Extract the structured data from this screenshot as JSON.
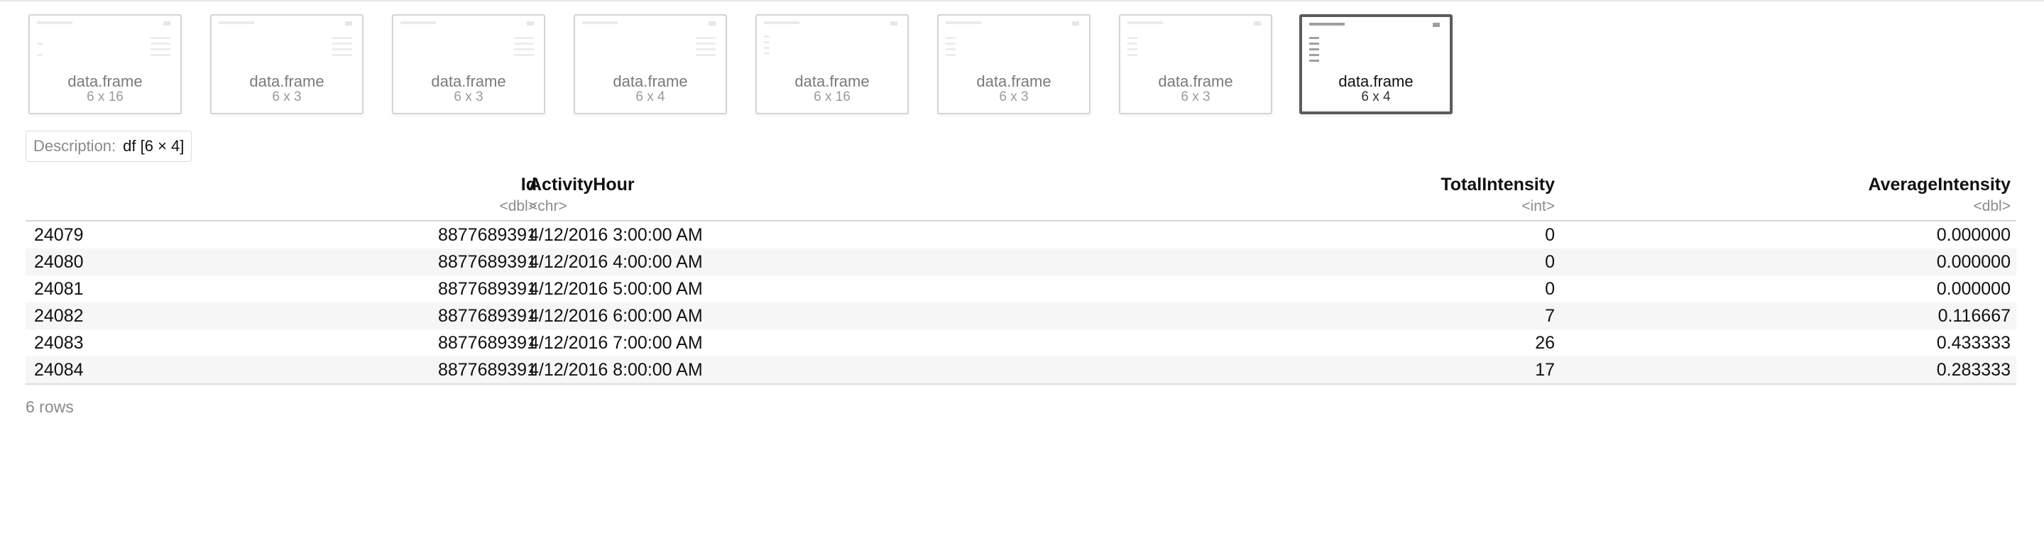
{
  "thumbnails": [
    {
      "name": "data.frame",
      "dims": "6 x 16",
      "active": false
    },
    {
      "name": "data.frame",
      "dims": "6 x 3",
      "active": false
    },
    {
      "name": "data.frame",
      "dims": "6 x 3",
      "active": false
    },
    {
      "name": "data.frame",
      "dims": "6 x 4",
      "active": false
    },
    {
      "name": "data.frame",
      "dims": "6 x 16",
      "active": false
    },
    {
      "name": "data.frame",
      "dims": "6 x 3",
      "active": false
    },
    {
      "name": "data.frame",
      "dims": "6 x 3",
      "active": false
    },
    {
      "name": "data.frame",
      "dims": "6 x 4",
      "active": true
    }
  ],
  "description": {
    "label": "Description:",
    "value": "df [6 × 4]"
  },
  "table": {
    "columns": [
      {
        "name": "Id",
        "type": "<dbl>"
      },
      {
        "name": "ActivityHour",
        "type": "<chr>"
      },
      {
        "name": "TotalIntensity",
        "type": "<int>"
      },
      {
        "name": "AverageIntensity",
        "type": "<dbl>"
      }
    ],
    "rows": [
      {
        "index": "24079",
        "id": "8877689391",
        "activity_hour": "4/12/2016 3:00:00 AM",
        "total_intensity": "0",
        "average_intensity": "0.000000"
      },
      {
        "index": "24080",
        "id": "8877689391",
        "activity_hour": "4/12/2016 4:00:00 AM",
        "total_intensity": "0",
        "average_intensity": "0.000000"
      },
      {
        "index": "24081",
        "id": "8877689391",
        "activity_hour": "4/12/2016 5:00:00 AM",
        "total_intensity": "0",
        "average_intensity": "0.000000"
      },
      {
        "index": "24082",
        "id": "8877689391",
        "activity_hour": "4/12/2016 6:00:00 AM",
        "total_intensity": "7",
        "average_intensity": "0.116667"
      },
      {
        "index": "24083",
        "id": "8877689391",
        "activity_hour": "4/12/2016 7:00:00 AM",
        "total_intensity": "26",
        "average_intensity": "0.433333"
      },
      {
        "index": "24084",
        "id": "8877689391",
        "activity_hour": "4/12/2016 8:00:00 AM",
        "total_intensity": "17",
        "average_intensity": "0.283333"
      }
    ]
  },
  "footer": {
    "row_count": "6 rows"
  }
}
